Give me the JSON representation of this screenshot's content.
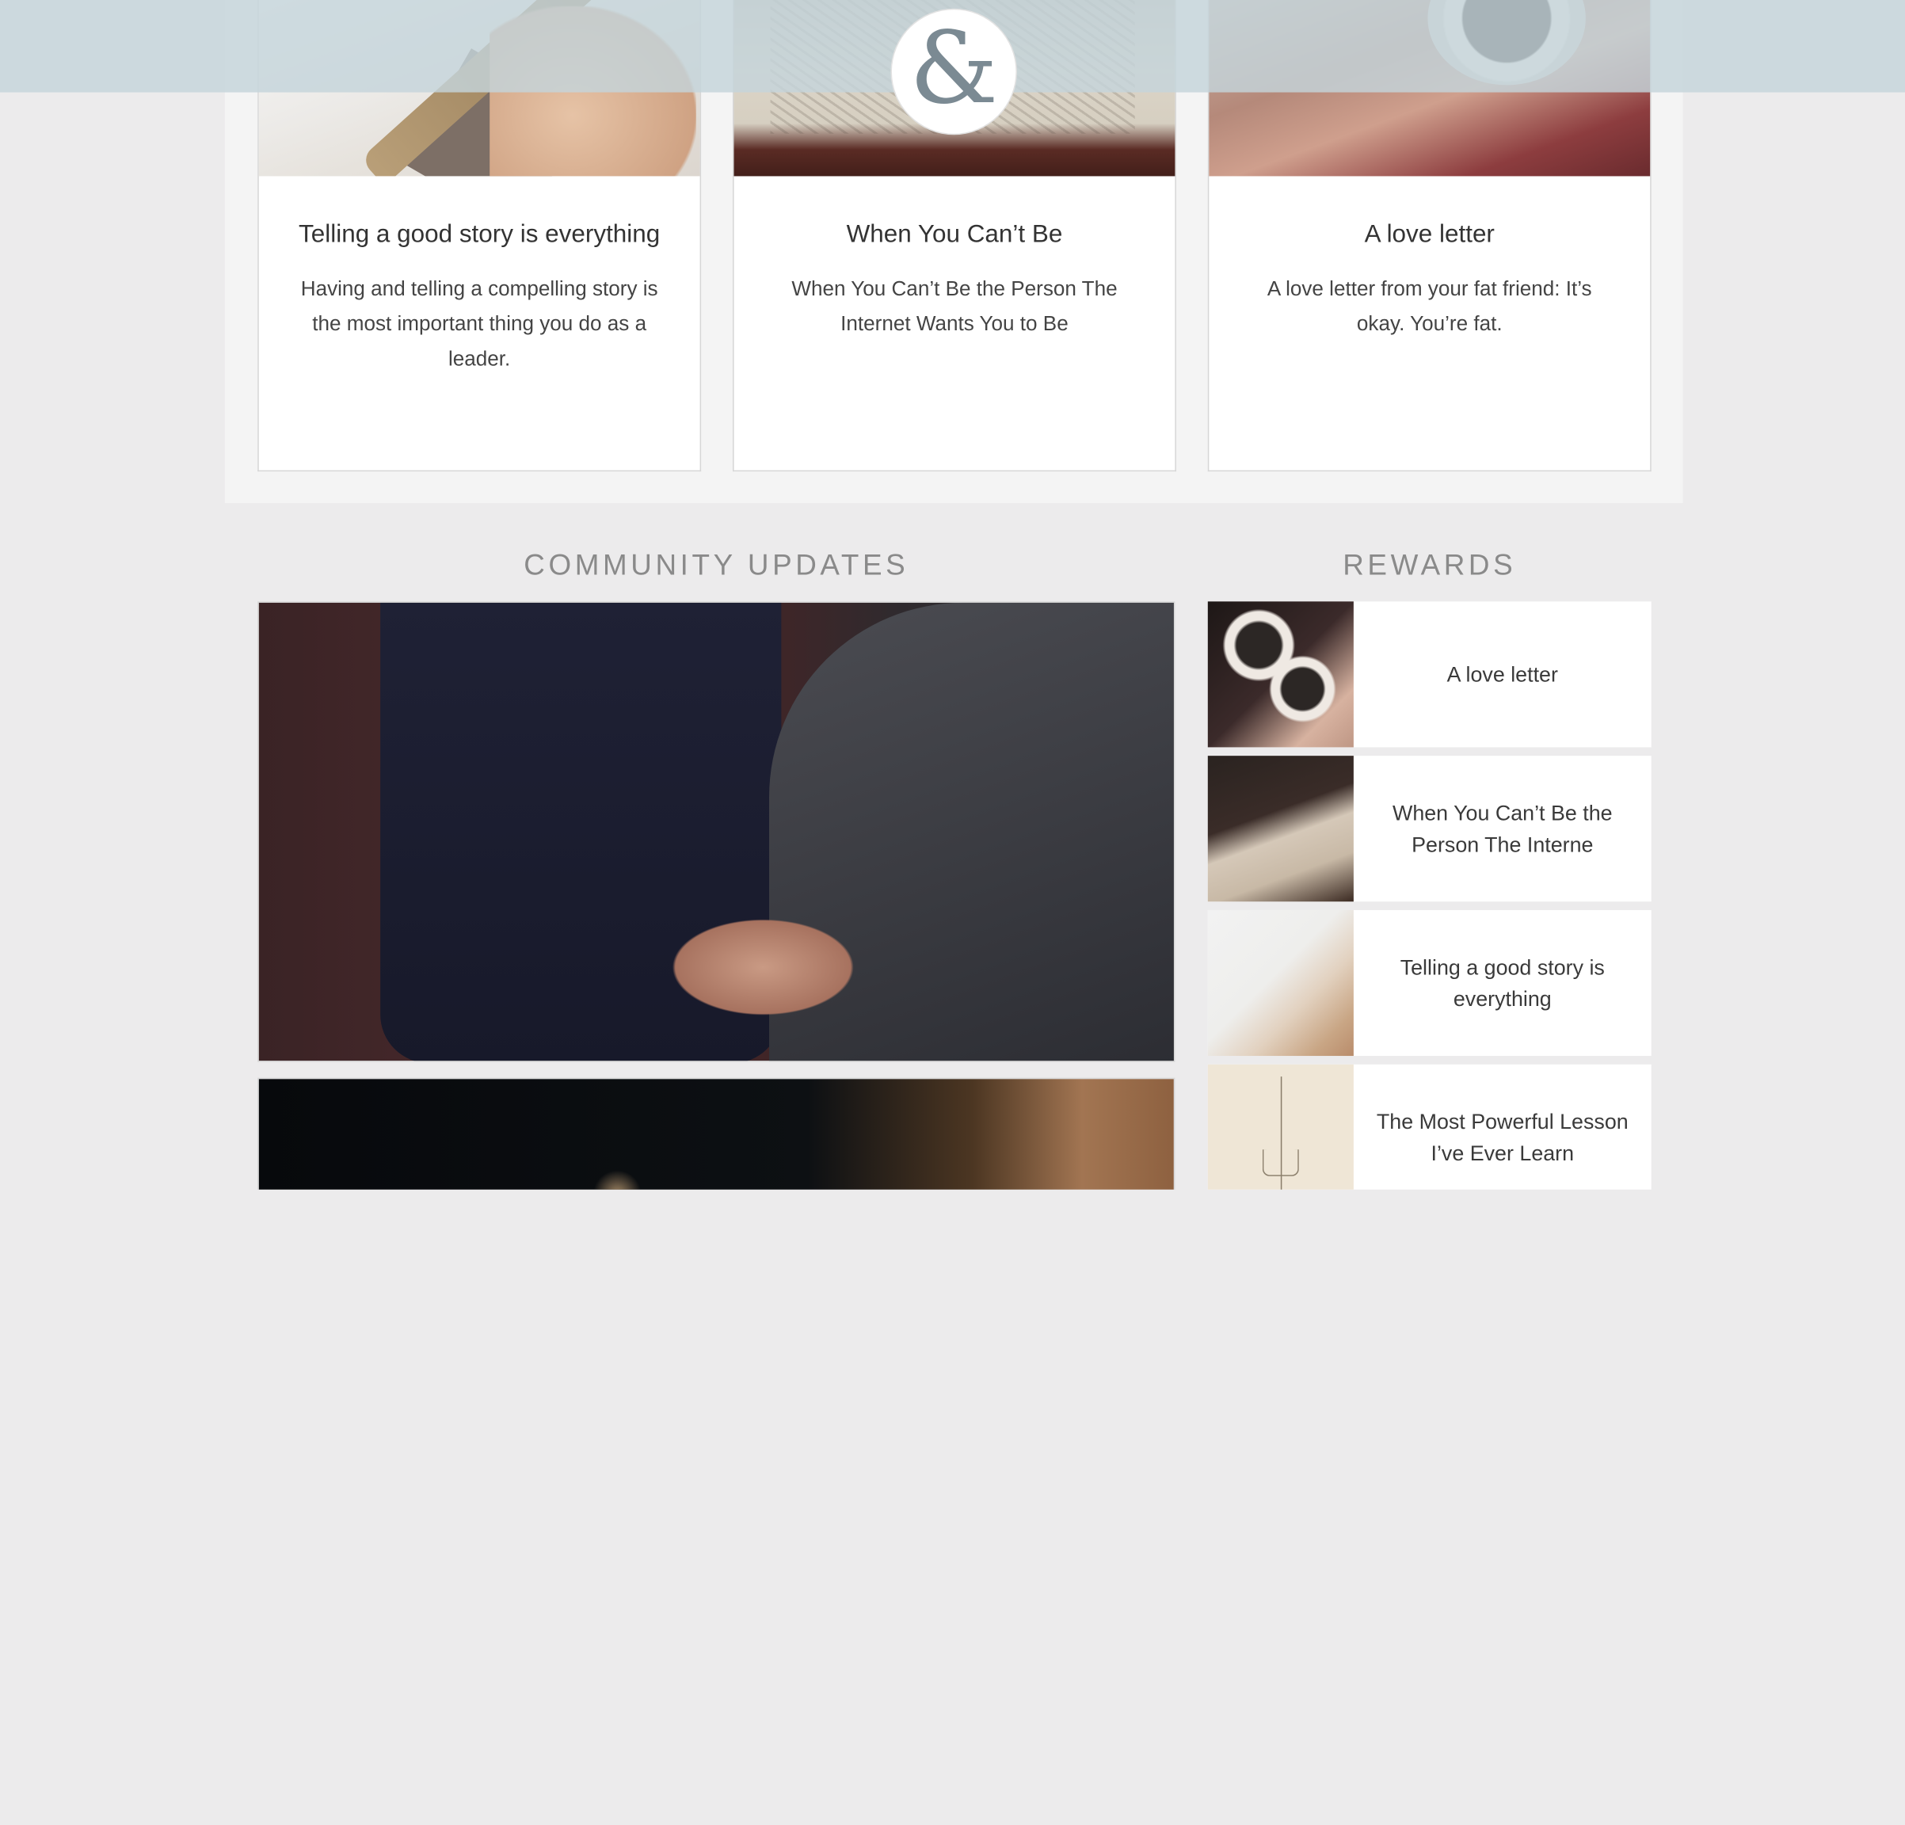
{
  "brand": {
    "logo_glyph": "&"
  },
  "featured_posts": [
    {
      "title": "Telling a good story is everything",
      "excerpt": "Having and telling a compelling story is the most important thing you do as a leader."
    },
    {
      "title": "When You Can’t Be",
      "excerpt": "When You Can’t Be the Person The Internet Wants You to Be"
    },
    {
      "title": "A love letter",
      "excerpt": "A love letter from your fat friend: It’s okay. You’re fat."
    }
  ],
  "community": {
    "heading": "COMMUNITY UPDATES"
  },
  "rewards": {
    "heading": "REWARDS",
    "items": [
      {
        "label": "A love letter"
      },
      {
        "label": "When You Can’t Be the Person The Interne"
      },
      {
        "label": "Telling a good story is everything"
      },
      {
        "label": "The Most Powerful Lesson I’ve Ever Learn"
      }
    ]
  },
  "colors": {
    "background": "#ecebec",
    "header_overlay": "#c4d4da",
    "panel": "#f4f4f4",
    "heading_text": "#8a8a8a"
  }
}
